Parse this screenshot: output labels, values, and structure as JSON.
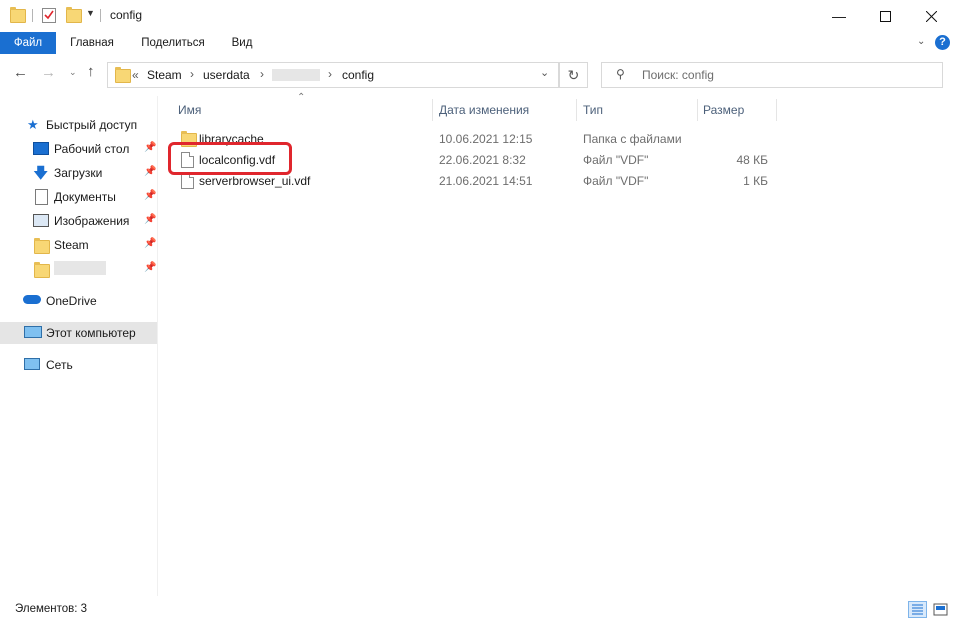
{
  "window": {
    "title": "config"
  },
  "ribbon": {
    "tabs": [
      "Файл",
      "Главная",
      "Поделиться",
      "Вид"
    ]
  },
  "address": {
    "prefix": "«",
    "crumbs": [
      "Steam",
      "userdata",
      "config"
    ]
  },
  "search": {
    "placeholder": "Поиск: config"
  },
  "sidebar": {
    "quick_access": "Быстрый доступ",
    "items": [
      "Рабочий стол",
      "Загрузки",
      "Документы",
      "Изображения",
      "Steam"
    ],
    "onedrive": "OneDrive",
    "this_pc": "Этот компьютер",
    "network": "Сеть"
  },
  "columns": {
    "name": "Имя",
    "date": "Дата изменения",
    "type": "Тип",
    "size": "Размер"
  },
  "files": [
    {
      "name": "librarycache",
      "date": "10.06.2021 12:15",
      "type": "Папка с файлами",
      "size": ""
    },
    {
      "name": "localconfig.vdf",
      "date": "22.06.2021 8:32",
      "type": "Файл \"VDF\"",
      "size": "48 КБ"
    },
    {
      "name": "serverbrowser_ui.vdf",
      "date": "21.06.2021 14:51",
      "type": "Файл \"VDF\"",
      "size": "1 КБ"
    }
  ],
  "status": {
    "items_count": "Элементов: 3"
  },
  "colors": {
    "accent": "#1a6fd1",
    "highlight": "#e0262d",
    "selected_bg": "#e5e5e5",
    "folder": "#f8d775"
  }
}
